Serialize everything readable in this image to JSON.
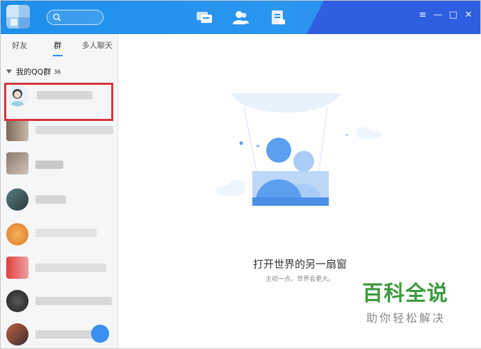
{
  "header": {
    "search_icon": "search-icon",
    "nav": [
      "message-icon",
      "contacts-icon",
      "space-icon"
    ],
    "window_controls": [
      "≡",
      "—",
      "□",
      "✕"
    ]
  },
  "sidebar": {
    "tabs": [
      {
        "label": "好友"
      },
      {
        "label": "群"
      },
      {
        "label": "多人聊天"
      }
    ],
    "group": {
      "label": "我的QQ群",
      "count": "36"
    }
  },
  "main": {
    "title": "打开世界的另一扇窗",
    "subtitle": "主动一点，世界会更大。"
  },
  "watermark": {
    "line1": "百科全说",
    "line2": "助你轻松解决"
  }
}
